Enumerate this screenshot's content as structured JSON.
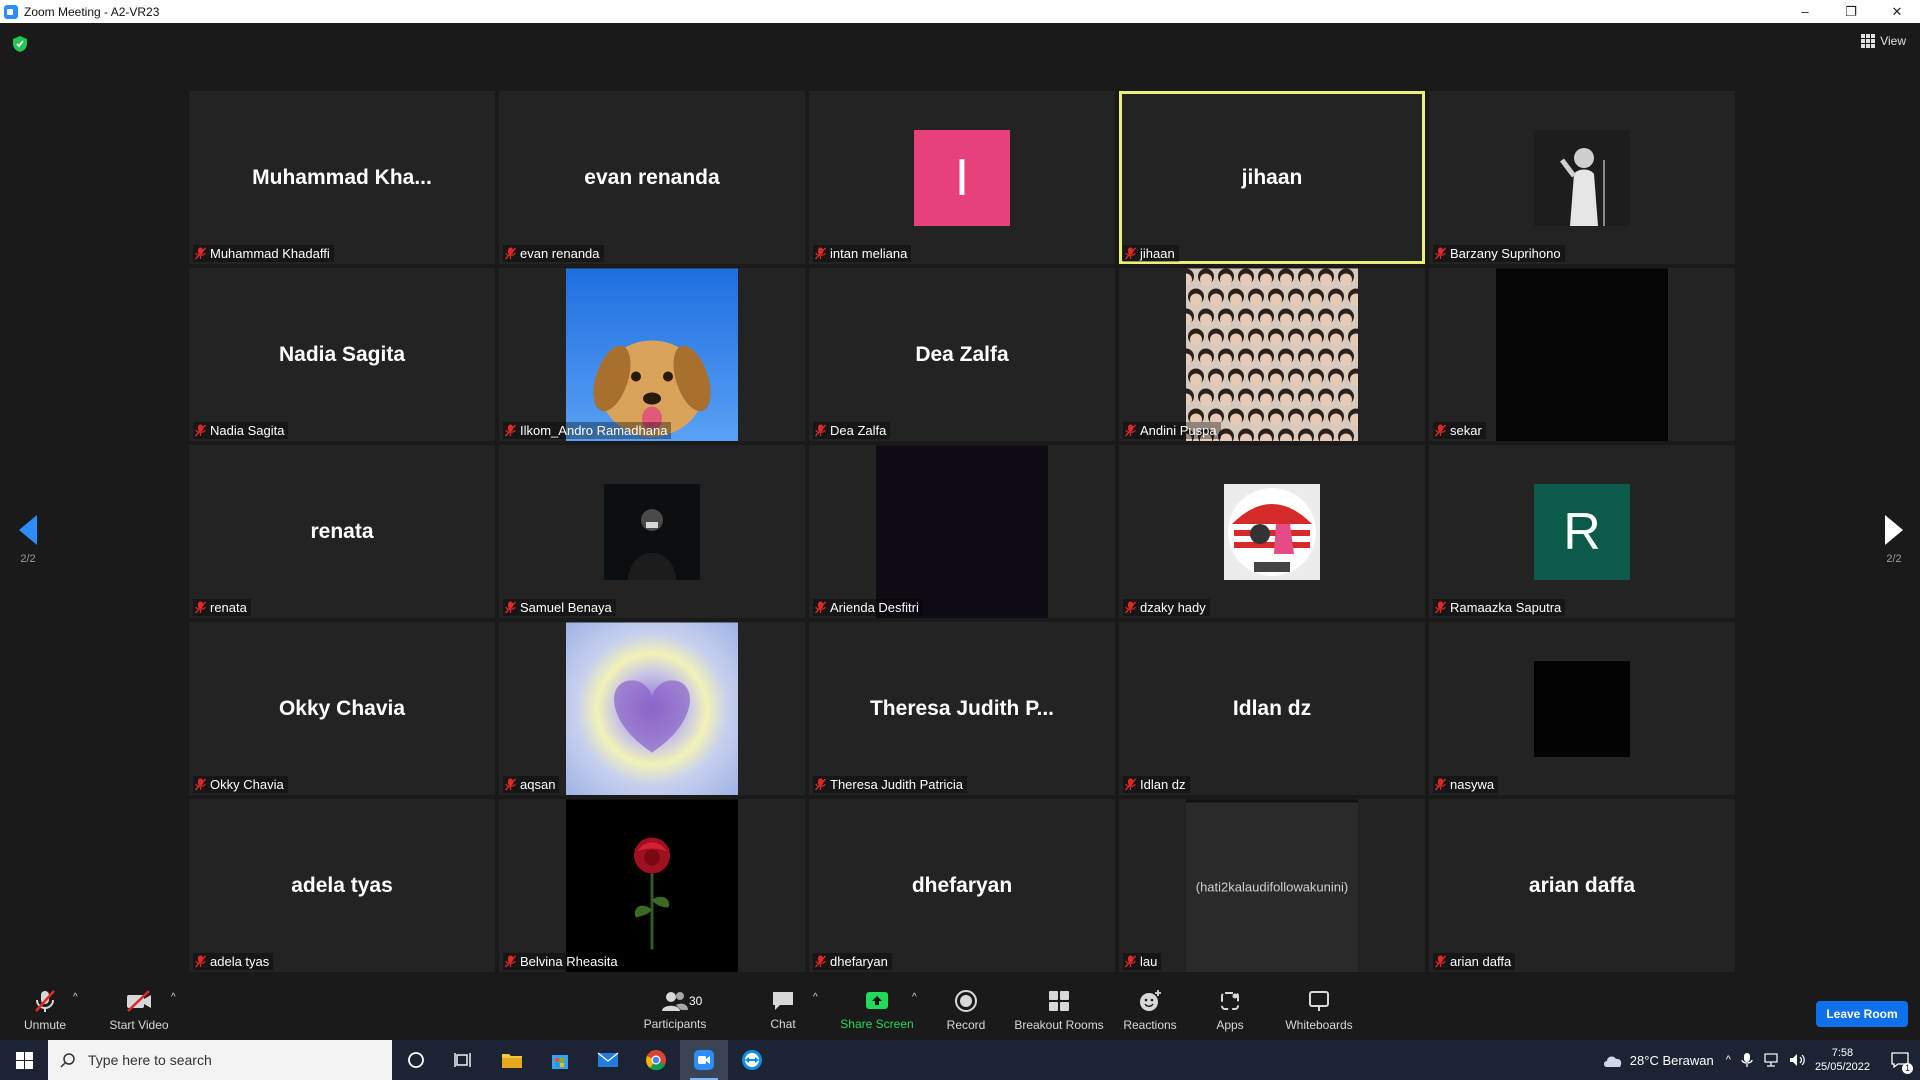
{
  "window": {
    "title": "Zoom Meeting - A2-VR23",
    "controls": [
      "–",
      "❐",
      "✕"
    ]
  },
  "view": {
    "label": "View"
  },
  "pagination": {
    "left": "2/2",
    "right": "2/2"
  },
  "colors": {
    "accent": "#2d8cff",
    "active_speaker": "#e8f07a",
    "muted": "#e02828",
    "leave": "#0e71eb",
    "share": "#23d959"
  },
  "tiles": [
    {
      "display": "Muhammad  Kha...",
      "label": "Muhammad Khadaffi",
      "kind": "name"
    },
    {
      "display": "evan renanda",
      "label": "evan renanda",
      "kind": "name"
    },
    {
      "display": "I",
      "label": "intan meliana",
      "kind": "letter",
      "color": "#e8407a"
    },
    {
      "display": "jihaan",
      "label": "jihaan",
      "kind": "name",
      "active": true
    },
    {
      "display": "",
      "label": "Barzany Suprihono",
      "kind": "photo-bw"
    },
    {
      "display": "Nadia Sagita",
      "label": "Nadia Sagita",
      "kind": "name"
    },
    {
      "display": "",
      "label": "Ilkom_Andro Ramadhana",
      "kind": "photo-dog"
    },
    {
      "display": "Dea Zalfa",
      "label": "Dea Zalfa",
      "kind": "name"
    },
    {
      "display": "",
      "label": "Andini Puspa",
      "kind": "photo-crowd"
    },
    {
      "display": "",
      "label": "sekar",
      "kind": "black-tall"
    },
    {
      "display": "renata",
      "label": "renata",
      "kind": "name"
    },
    {
      "display": "",
      "label": "Samuel Benaya",
      "kind": "photo-dark"
    },
    {
      "display": "",
      "label": "Arienda Desfitri",
      "kind": "dark-tall"
    },
    {
      "display": "",
      "label": "dzaky hady",
      "kind": "photo-persija",
      "badge": "PERSIJA"
    },
    {
      "display": "R",
      "label": "Ramaazka Saputra",
      "kind": "letter",
      "color": "#0b5a4a"
    },
    {
      "display": "Okky Chavia",
      "label": "Okky Chavia",
      "kind": "name"
    },
    {
      "display": "",
      "label": "aqsan",
      "kind": "photo-heart"
    },
    {
      "display": "Theresa Judith P...",
      "label": "Theresa Judith Patricia",
      "kind": "name"
    },
    {
      "display": "Idlan dz",
      "label": "Idlan dz",
      "kind": "name"
    },
    {
      "display": "",
      "label": "nasywa",
      "kind": "black-sq"
    },
    {
      "display": "adela tyas",
      "label": "adela tyas",
      "kind": "name"
    },
    {
      "display": "",
      "label": "Belvina Rheasita",
      "kind": "photo-rose"
    },
    {
      "display": "dhefaryan",
      "label": "dhefaryan",
      "kind": "name"
    },
    {
      "display": "(hati2kalaudifollowakunini)",
      "label": "lau",
      "kind": "text-tall"
    },
    {
      "display": "arian daffa",
      "label": "arian daffa",
      "kind": "name"
    }
  ],
  "toolbar": {
    "unmute": "Unmute",
    "start_video": "Start Video",
    "participants": "Participants",
    "participants_count": "30",
    "chat": "Chat",
    "share_screen": "Share Screen",
    "record": "Record",
    "breakout_rooms": "Breakout Rooms",
    "reactions": "Reactions",
    "apps": "Apps",
    "whiteboards": "Whiteboards",
    "leave": "Leave Room"
  },
  "taskbar": {
    "search_placeholder": "Type here to search",
    "weather": "28°C  Berawan",
    "time": "7:58",
    "date": "25/05/2022",
    "notifications": "1"
  }
}
